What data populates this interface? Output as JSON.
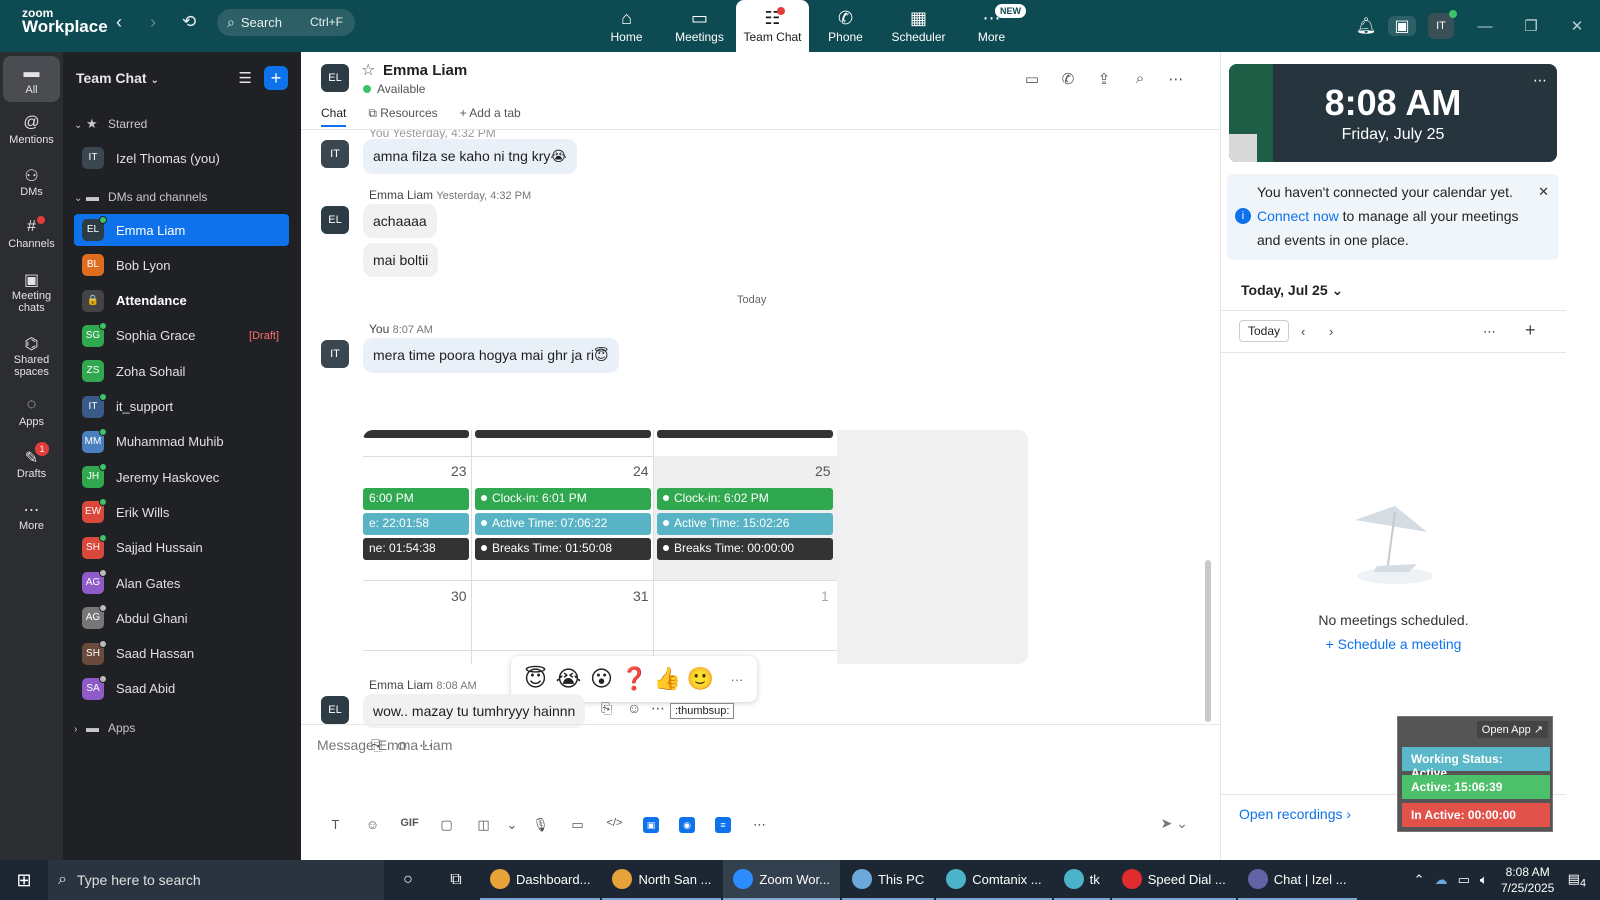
{
  "app": {
    "logo_line1": "zoom",
    "logo_line2": "Workplace",
    "back": "‹",
    "forward": "›",
    "history_icon": "clock-history-icon"
  },
  "search": {
    "label": "Search",
    "shortcut": "Ctrl+F"
  },
  "nav": [
    {
      "label": "Home",
      "icon": "⌂"
    },
    {
      "label": "Meetings",
      "icon": "▭"
    },
    {
      "label": "Team Chat",
      "icon": "☷"
    },
    {
      "label": "Phone",
      "icon": "✆"
    },
    {
      "label": "Scheduler",
      "icon": "▦"
    },
    {
      "label": "More",
      "icon": "⋯",
      "badge": "NEW"
    }
  ],
  "topright": {
    "avatar": "IT"
  },
  "rail": [
    {
      "label": "All",
      "icon": "▬"
    },
    {
      "label": "Mentions",
      "icon": "@"
    },
    {
      "label": "DMs",
      "icon": "⚇"
    },
    {
      "label": "Channels",
      "icon": "#"
    },
    {
      "label": "Meeting chats",
      "icon": "▣"
    },
    {
      "label": "Shared spaces",
      "icon": "⌬"
    },
    {
      "label": "Apps",
      "icon": "◌"
    },
    {
      "label": "Drafts",
      "icon": "✎",
      "badge": "1"
    },
    {
      "label": "More",
      "icon": "⋯"
    }
  ],
  "sidebar": {
    "title": "Team Chat",
    "starred_label": "Starred",
    "starred": [
      {
        "initials": "IT",
        "name": "Izel Thomas (you)",
        "color": "#3a4650"
      }
    ],
    "dms_label": "DMs and channels",
    "contacts": [
      {
        "initials": "EL",
        "name": "Emma Liam",
        "color": "#2d3b45",
        "presence": "#3cc36a"
      },
      {
        "initials": "BL",
        "name": "Bob Lyon",
        "color": "#e06c1f",
        "presence": ""
      },
      {
        "initials": "🔒",
        "name": "Attendance",
        "color": "#444",
        "presence": ""
      },
      {
        "initials": "SG",
        "name": "Sophia Grace",
        "color": "#2fa84f",
        "presence": "#3cc36a",
        "draft": "[Draft]"
      },
      {
        "initials": "ZS",
        "name": "Zoha Sohail",
        "color": "#2fa84f",
        "presence": ""
      },
      {
        "initials": "IT",
        "name": "it_support",
        "color": "#3a5a8a",
        "presence": "#3cc36a"
      },
      {
        "initials": "MM",
        "name": "Muhammad Muhib",
        "color": "#4a7fc0",
        "presence": "#3cc36a"
      },
      {
        "initials": "JH",
        "name": "Jeremy Haskovec",
        "color": "#2fa84f",
        "presence": "#3cc36a"
      },
      {
        "initials": "EW",
        "name": "Erik Wills",
        "color": "#d9483b",
        "presence": "#3cc36a"
      },
      {
        "initials": "SH",
        "name": "Sajjad Hussain",
        "color": "#d9483b",
        "presence": "#3cc36a"
      },
      {
        "initials": "AG",
        "name": "Alan Gates",
        "color": "#8e5bc9",
        "presence": "#bbb"
      },
      {
        "initials": "AG",
        "name": "Abdul Ghani",
        "color": "#777",
        "presence": "#bbb"
      },
      {
        "initials": "SH",
        "name": "Saad Hassan",
        "color": "#6a4a3a",
        "presence": "#bbb"
      },
      {
        "initials": "SA",
        "name": "Saad Abid",
        "color": "#8e5bc9",
        "presence": "#bbb"
      }
    ],
    "apps_label": "Apps"
  },
  "chat": {
    "name": "Emma Liam",
    "initials": "EL",
    "status": "Available",
    "tabs": [
      {
        "label": "Chat"
      },
      {
        "label": "Resources"
      },
      {
        "label": "+ Add a tab"
      }
    ],
    "prev_header": "You Yesterday, 4:32 PM",
    "messages": {
      "m1": "amna filza se kaho ni tng kry😭",
      "h2_name": "Emma Liam",
      "h2_time": "Yesterday, 4:32 PM",
      "m2": "achaaaa",
      "m3": "mai boltii",
      "day": "Today",
      "h3_name": "You",
      "h3_time": "8:07 AM",
      "m4": "mera time poora hogya mai ghr ja ri😇",
      "h4_name": "Emma Liam",
      "h4_time": "8:08 AM",
      "m5": "wow.. mazay tu tumhryyy hainnn"
    },
    "calendar": {
      "days_row1": [
        "23",
        "24",
        "25"
      ],
      "days_row2": [
        "30",
        "31",
        "1"
      ],
      "col1": [
        "6:00 PM",
        "e: 22:01:58",
        "ne: 01:54:38"
      ],
      "col2": [
        "Clock-in: 6:01 PM",
        "Active Time: 07:06:22",
        "Breaks Time: 01:50:08"
      ],
      "col3": [
        "Clock-in: 6:02 PM",
        "Active Time: 15:02:26",
        "Breaks Time: 00:00:00"
      ]
    },
    "reactions": [
      "😇",
      "😭",
      "😮",
      "❓",
      "👍",
      "🙂",
      "···"
    ],
    "tooltip": ":thumbsup:",
    "composer_placeholder": "Message Emma Liam",
    "composer_tools": [
      "T",
      "☺",
      "GIF",
      "▢",
      "◫",
      "⌄",
      "🎙",
      "▭",
      "</>",
      "⋯"
    ]
  },
  "right": {
    "time": "8:08 AM",
    "date": "Friday, July 25",
    "notice_a": "You haven't connected your calendar yet.",
    "notice_link": "Connect now",
    "notice_b": "to manage all your meetings and events in one place.",
    "today_header": "Today, Jul 25",
    "today_btn": "Today",
    "empty": "No meetings scheduled.",
    "schedule": "Schedule a meeting",
    "open_recordings": "Open recordings",
    "overlay": {
      "open_app": "Open App ↗",
      "working": "Working Status: Active",
      "active": "Active: 15:06:39",
      "inactive": "In Active: 00:00:00",
      "colors": {
        "working": "#5bb8c8",
        "active": "#4cc06a",
        "inactive": "#e0524a"
      }
    }
  },
  "taskbar": {
    "search": "Type here to search",
    "apps": [
      {
        "label": "Dashboard...",
        "color": "#e8a23a"
      },
      {
        "label": "North San ...",
        "color": "#e8a23a"
      },
      {
        "label": "Zoom Wor...",
        "color": "#2d8cff",
        "active": true
      },
      {
        "label": "This PC",
        "color": "#6aa9d9"
      },
      {
        "label": "Comtanix ...",
        "color": "#4ab3c9"
      },
      {
        "label": "tk",
        "color": "#4ab3c9"
      },
      {
        "label": "Speed Dial ...",
        "color": "#e02c2c"
      },
      {
        "label": "Chat | Izel ...",
        "color": "#6264a7"
      }
    ],
    "time": "8:08 AM",
    "date": "7/25/2025",
    "notif": "4"
  }
}
